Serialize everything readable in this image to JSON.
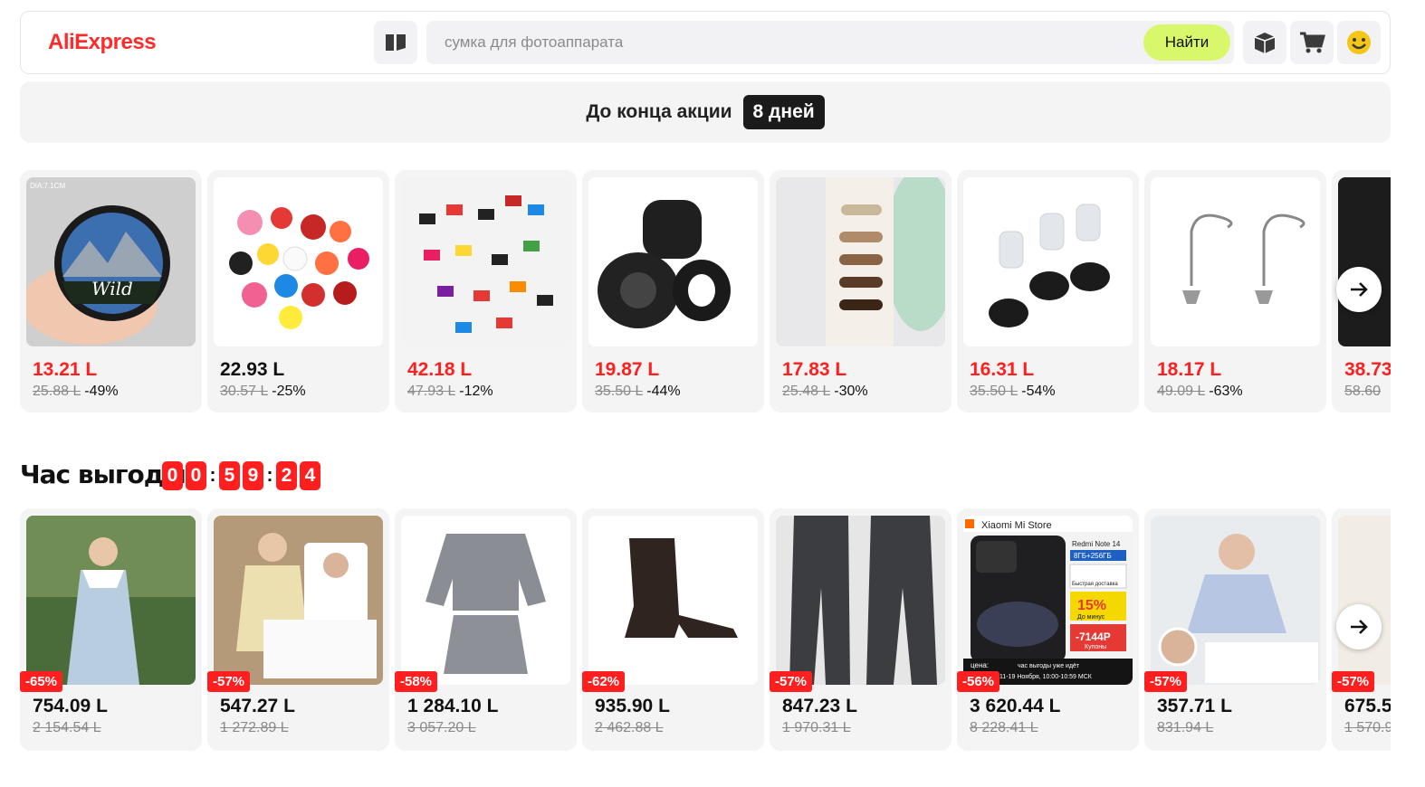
{
  "header": {
    "logo": "AliExpress",
    "search_placeholder": "сумка для фотоаппарата",
    "search_button": "Найти"
  },
  "banner": {
    "text": "До конца акции",
    "badge": "8 дней"
  },
  "row1": [
    {
      "price": "13.21 L",
      "old": "25.88 L",
      "discount": "-49%",
      "red": true,
      "thumb_label": "DIA:7.1CM"
    },
    {
      "price": "22.93 L",
      "old": "30.57 L",
      "discount": "-25%",
      "red": false
    },
    {
      "price": "42.18 L",
      "old": "47.93 L",
      "discount": "-12%",
      "red": true
    },
    {
      "price": "19.87 L",
      "old": "35.50 L",
      "discount": "-44%",
      "red": true
    },
    {
      "price": "17.83 L",
      "old": "25.48 L",
      "discount": "-30%",
      "red": true
    },
    {
      "price": "16.31 L",
      "old": "35.50 L",
      "discount": "-54%",
      "red": true
    },
    {
      "price": "18.17 L",
      "old": "49.09 L",
      "discount": "-63%",
      "red": true
    },
    {
      "price": "38.73",
      "old": "58.60",
      "discount": "",
      "red": true
    }
  ],
  "deal": {
    "title": "Час выгоды",
    "timer": [
      "0",
      "0",
      "5",
      "9",
      "2",
      "4"
    ]
  },
  "row2": [
    {
      "price": "754.09 L",
      "old": "2 154.54 L",
      "badge": "-65%"
    },
    {
      "price": "547.27 L",
      "old": "1 272.89 L",
      "badge": "-57%"
    },
    {
      "price": "1 284.10 L",
      "old": "3 057.20 L",
      "badge": "-58%"
    },
    {
      "price": "935.90 L",
      "old": "2 462.88 L",
      "badge": "-62%"
    },
    {
      "price": "847.23 L",
      "old": "1 970.31 L",
      "badge": "-57%"
    },
    {
      "price": "3 620.44 L",
      "old": "8 228.41 L",
      "badge": "-56%",
      "store": "Xiaomi Mi Store",
      "promo": [
        "Redmi Note 14",
        "8ГБ+256ГБ",
        "Быстрая доставка",
        "15%",
        "До минус",
        "-7144Р",
        "Купоны",
        "цена:",
        "час выгоды уже идёт",
        "11-19 Ноября, 10:00-10:59 МСК"
      ]
    },
    {
      "price": "357.71 L",
      "old": "831.94 L",
      "badge": "-57%"
    },
    {
      "price": "675.5",
      "old": "1 570.9",
      "badge": "-57%"
    }
  ]
}
